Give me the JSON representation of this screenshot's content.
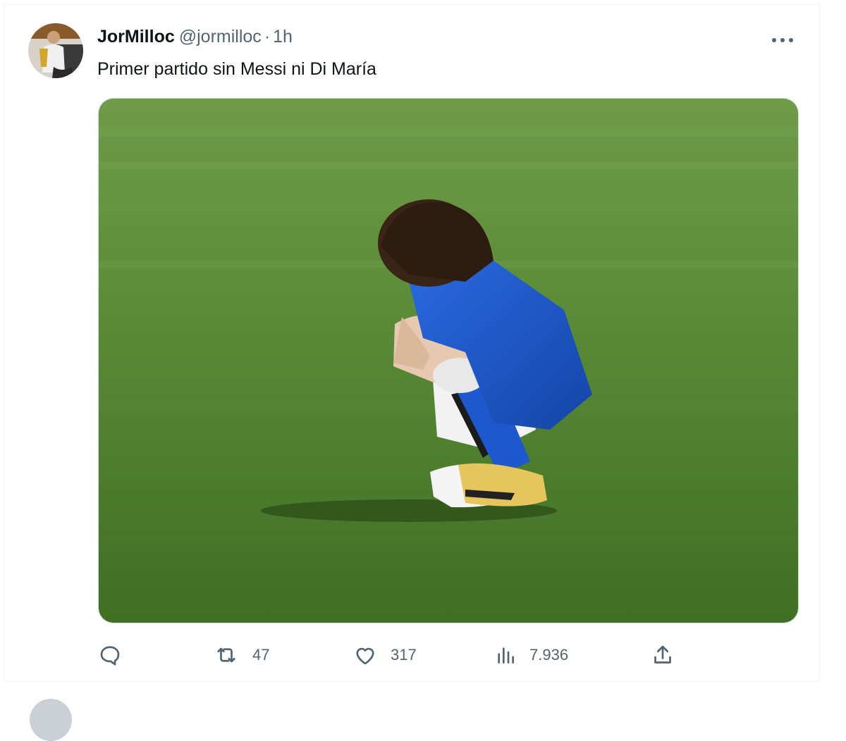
{
  "tweet": {
    "author_name": "JorMilloc",
    "author_handle": "@jormilloc",
    "separator": "·",
    "time": "1h",
    "text": "Primer partido sin Messi ni Di María"
  },
  "actions": {
    "reply": {
      "icon": "reply-icon",
      "count": ""
    },
    "retweet": {
      "icon": "retweet-icon",
      "count": "47"
    },
    "like": {
      "icon": "heart-icon",
      "count": "317"
    },
    "views": {
      "icon": "views-chart-icon",
      "count": "7.936"
    },
    "share": {
      "icon": "share-icon",
      "count": ""
    }
  },
  "colors": {
    "text_primary": "#0f1419",
    "text_secondary": "#536471",
    "border": "#eff3f4",
    "grass": "#4a7a2a",
    "jersey": "#1a55c9"
  }
}
